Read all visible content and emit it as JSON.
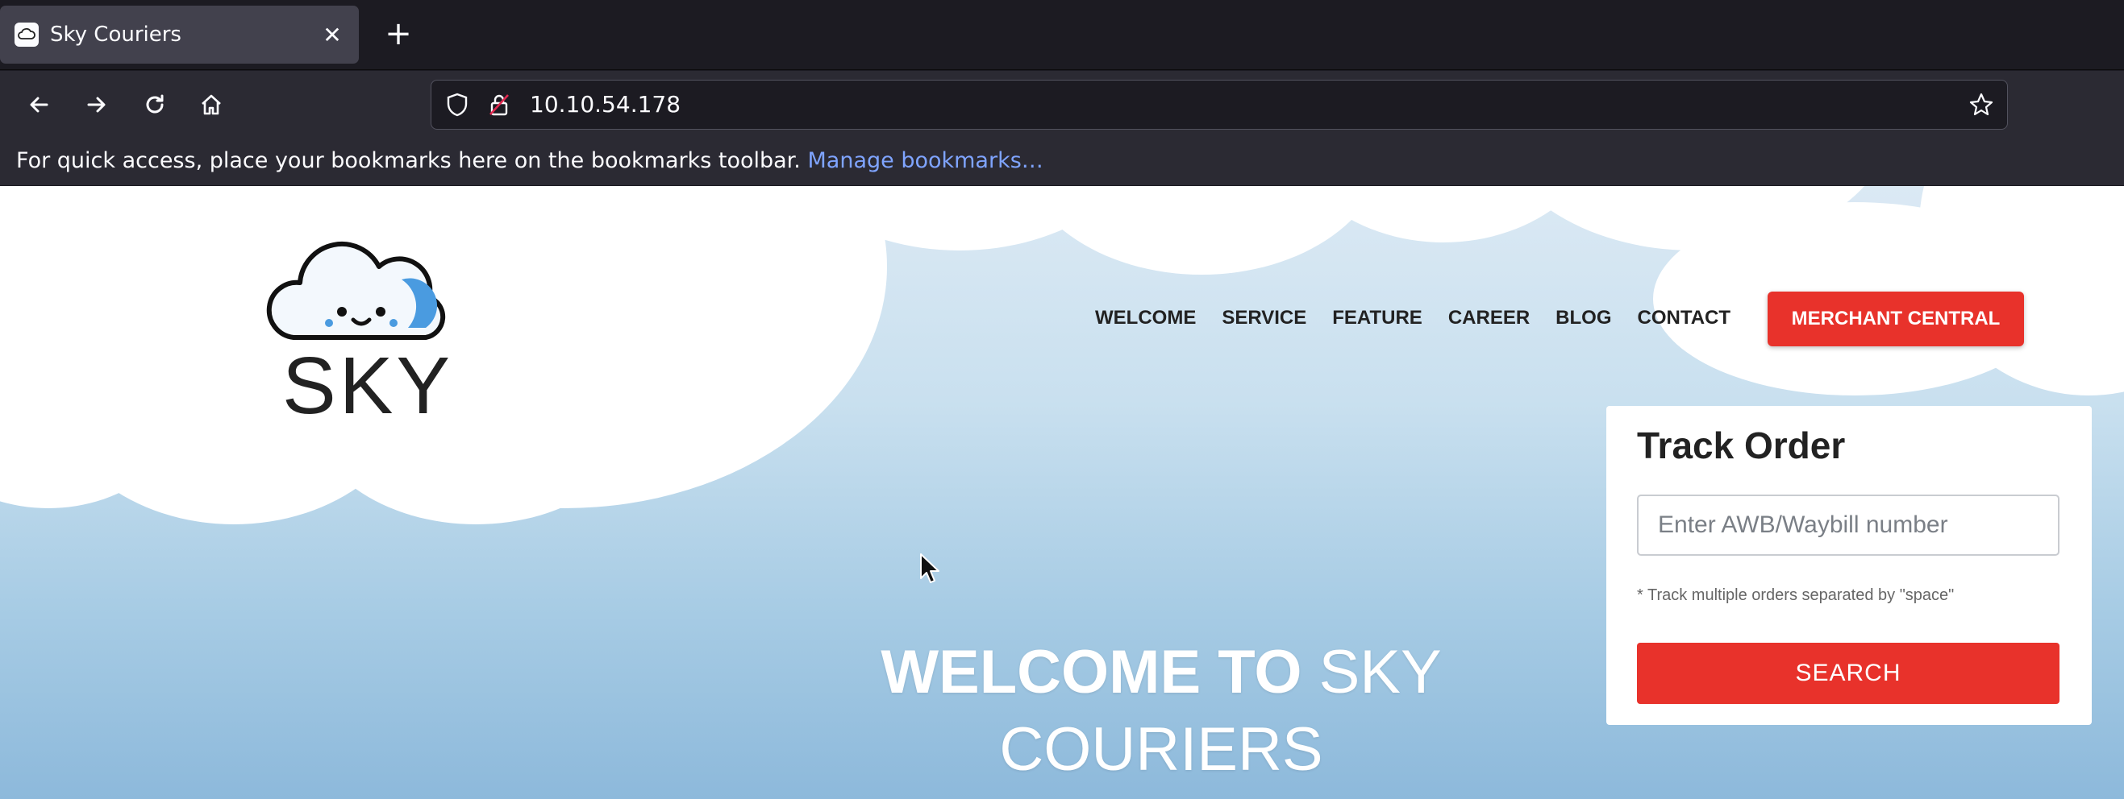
{
  "browser": {
    "tab": {
      "title": "Sky Couriers",
      "close_glyph": "✕"
    },
    "new_tab_glyph": "+",
    "url": "10.10.54.178",
    "bookmarks": {
      "message": "For quick access, place your bookmarks here on the bookmarks toolbar.",
      "link": "Manage bookmarks…"
    }
  },
  "site": {
    "logo_text": "SKY",
    "nav": {
      "items": [
        "WELCOME",
        "SERVICE",
        "FEATURE",
        "CAREER",
        "BLOG",
        "CONTACT"
      ],
      "cta": "MERCHANT CENTRAL"
    },
    "track": {
      "title": "Track Order",
      "placeholder": "Enter AWB/Waybill number",
      "note": "* Track multiple orders separated by \"space\"",
      "button": "SEARCH"
    },
    "hero": {
      "bold": "WELCOME TO",
      "light": "SKY COURIERS"
    }
  },
  "colors": {
    "accent": "#e8322b",
    "chrome_dark": "#1c1b22",
    "chrome": "#2b2a33",
    "link": "#7fa4ff"
  }
}
